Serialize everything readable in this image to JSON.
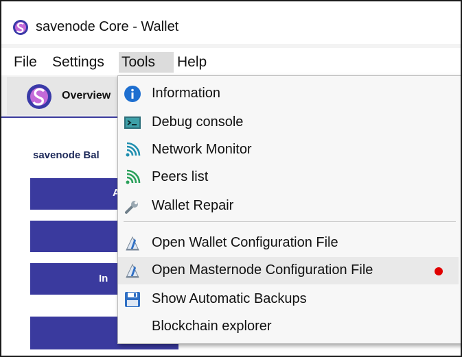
{
  "window": {
    "title": "savenode Core - Wallet"
  },
  "menubar": {
    "items": [
      {
        "label": "File"
      },
      {
        "label": "Settings"
      },
      {
        "label": "Tools"
      },
      {
        "label": "Help"
      }
    ],
    "active": "Tools"
  },
  "toolbar": {
    "overview_label": "Overview"
  },
  "main": {
    "balance_label": "savenode Bal",
    "button_fragments": [
      "A",
      "In"
    ]
  },
  "tools_menu": {
    "items": [
      {
        "label": "Information",
        "icon": "info-icon"
      },
      {
        "label": "Debug console",
        "icon": "console-icon"
      },
      {
        "label": "Network Monitor",
        "icon": "network-signal-icon"
      },
      {
        "label": "Peers list",
        "icon": "peers-signal-icon"
      },
      {
        "label": "Wallet Repair",
        "icon": "wrench-icon"
      },
      {
        "label": "Open Wallet Configuration File",
        "icon": "config-file-icon"
      },
      {
        "label": "Open Masternode Configuration File",
        "icon": "config-file-icon"
      },
      {
        "label": "Show Automatic Backups",
        "icon": "save-disk-icon"
      },
      {
        "label": "Blockchain explorer",
        "icon": ""
      }
    ],
    "highlighted": "Open Masternode Configuration File"
  },
  "colors": {
    "accent": "#3a3a9e",
    "marker": "#e00000",
    "info_blue": "#1e6fd0"
  }
}
